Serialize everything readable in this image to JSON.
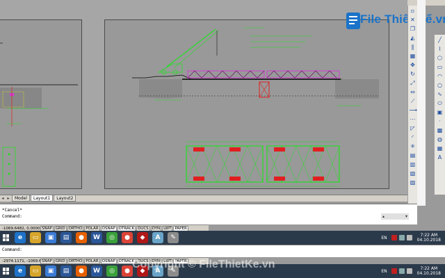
{
  "watermark": {
    "brand": "File Thiết Kế.vn",
    "copyright": "Copyright © FileThietKe.vn"
  },
  "tabs": [
    {
      "label": "Model",
      "active": false
    },
    {
      "label": "Layout1",
      "active": true
    },
    {
      "label": "Layout2",
      "active": false
    }
  ],
  "command": {
    "line1": "*Cancel*",
    "line2": "Command:",
    "lower_prompt": "Command:"
  },
  "status": {
    "coords_top": "-1069.6482, 0.0000",
    "coords_bottom": "-2974.1171, -1069.6482, 0.0000",
    "buttons_top": [
      "SNAP",
      "GRID",
      "ORTHO",
      "POLAR",
      "OSNAP",
      "OTRACK",
      "DUCS",
      "DYN",
      "LWT",
      "PAPER"
    ],
    "buttons_bottom": [
      "SNAP",
      "GRID",
      "ORTHO",
      "POLAR",
      "OSNAP",
      "OTRACK",
      "DUCS",
      "DYN",
      "LWT",
      "PAPER"
    ]
  },
  "taskbar": {
    "lang": "EN",
    "time": "7:22 AM",
    "date": "04.10.2018",
    "apps": [
      {
        "name": "ie",
        "glyph": "e",
        "color": "#1e73c8"
      },
      {
        "name": "explorer",
        "glyph": "▭",
        "color": "#d6a52a"
      },
      {
        "name": "store",
        "glyph": "▣",
        "color": "#3a7bd5"
      },
      {
        "name": "word-doc",
        "glyph": "▤",
        "color": "#2b5797"
      },
      {
        "name": "firefox",
        "glyph": "●",
        "color": "#e66000"
      },
      {
        "name": "word",
        "glyph": "W",
        "color": "#2b579a"
      },
      {
        "name": "app-green",
        "glyph": "◎",
        "color": "#3aa03a"
      },
      {
        "name": "chrome",
        "glyph": "●",
        "color": "#db4437"
      },
      {
        "name": "app-red",
        "glyph": "◆",
        "color": "#b01818"
      },
      {
        "name": "autocad",
        "glyph": "A",
        "color": "#6aa4c8"
      },
      {
        "name": "app-paint",
        "glyph": "✎",
        "color": "#8c8c8c"
      }
    ]
  },
  "colors": {
    "canvas_bg": "#a6a6a6",
    "drawing_green": "#22e022",
    "drawing_magenta": "#d23cd2",
    "drawing_red": "#e02020",
    "taskbar_bg": "#2b3a4b"
  },
  "icons": {
    "toolbar": [
      "line-icon",
      "polyline-icon",
      "circle-icon",
      "arc-icon",
      "rectangle-icon",
      "move-icon",
      "copy-icon",
      "rotate-icon",
      "scale-icon",
      "trim-icon",
      "extend-icon",
      "offset-icon"
    ]
  }
}
